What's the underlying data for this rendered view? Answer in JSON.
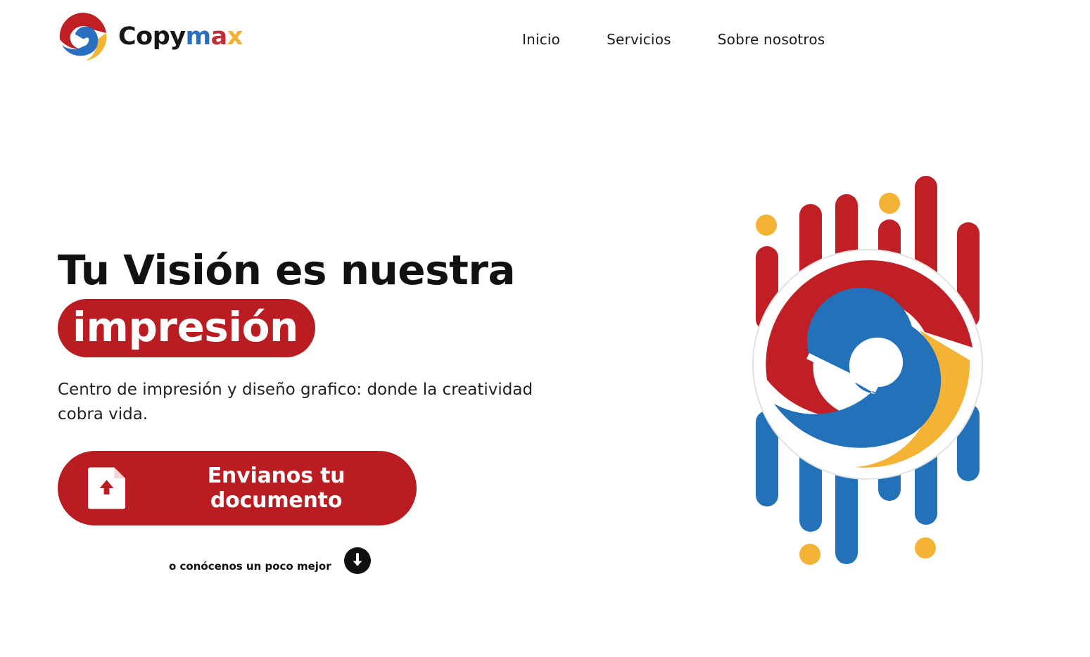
{
  "header": {
    "logo": {
      "part1": "Copy",
      "part_m": "m",
      "part_a": "a",
      "part_x": "x",
      "icon": "copymax-logo-icon"
    },
    "nav": [
      {
        "label": "Inicio"
      },
      {
        "label": "Servicios"
      },
      {
        "label": "Sobre nosotros"
      }
    ]
  },
  "hero": {
    "title_line1": "Tu Visión es nuestra",
    "title_highlight": "impresión",
    "subtitle": "Centro de impresión y diseño grafico: donde la creatividad cobra vida.",
    "cta": {
      "label": "Envianos tu documento",
      "icon": "document-upload-icon"
    },
    "more": {
      "label": "o conócenos un poco mejor",
      "icon": "arrow-down-circle-icon"
    },
    "illustration": "copymax-emblem-illustration"
  },
  "colors": {
    "brand_red": "#b91d21",
    "brand_blue": "#2a6fbf",
    "brand_yellow": "#f5b335",
    "text": "#111111",
    "background": "#ffffff"
  }
}
